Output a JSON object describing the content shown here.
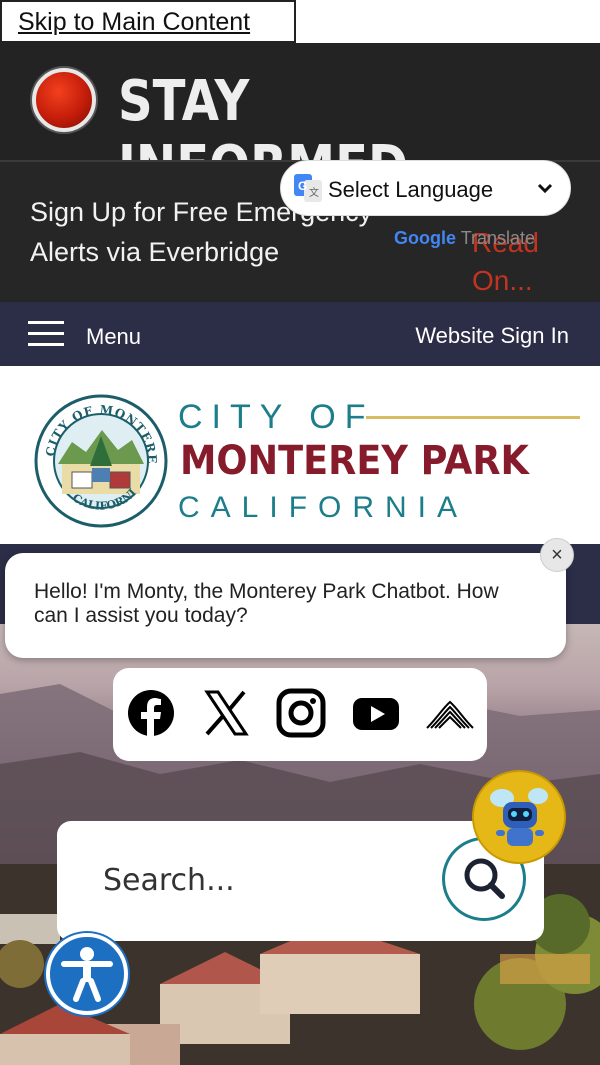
{
  "skip_link": "Skip to Main Content",
  "stay_informed": {
    "title": "STAY INFORMED"
  },
  "alert_banner": {
    "text": "Sign Up for Free Emergency Alerts via Everbridge",
    "more": "Read On..."
  },
  "language": {
    "label": "Select Language",
    "powered_google": "Google",
    "powered_translate": "Translate"
  },
  "nav": {
    "menu_label": "Menu",
    "signin_label": "Website Sign In"
  },
  "logo": {
    "city_of": "CITY OF",
    "name": "MONTEREY PARK",
    "state": "CALIFORNIA",
    "seal_top": "CITY OF MONTEREY PARK",
    "seal_bottom": "CALIFORNIA"
  },
  "chat": {
    "message": "Hello! I'm Monty, the Monterey Park Chatbot. How can I assist you today?",
    "close": "×"
  },
  "social": {
    "icons": [
      "facebook-icon",
      "x-icon",
      "instagram-icon",
      "youtube-icon",
      "nextdoor-icon"
    ]
  },
  "search": {
    "placeholder": "Search..."
  },
  "colors": {
    "dark_bar": "#232323",
    "nav_bg": "#2c2e47",
    "teal": "#1b7e8a",
    "maroon": "#861c2b",
    "gold": "#d8bc63",
    "alert_red": "#c33321",
    "accessibility_blue": "#1d6fc2"
  }
}
